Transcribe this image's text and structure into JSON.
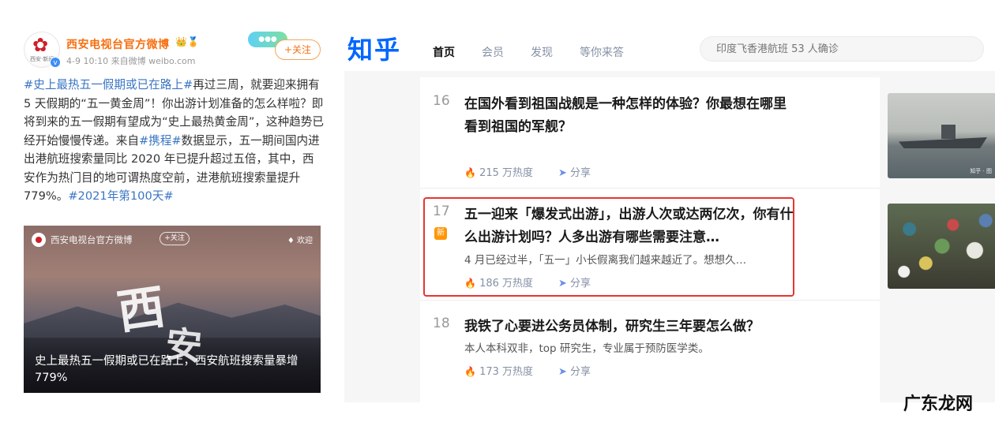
{
  "weibo": {
    "account_name": "西安电视台官方微博",
    "name_icons": "👑🏅",
    "meta": "4-9 10:10  来自微博 weibo.com",
    "tag_badge": "●●●",
    "follow_label": "+关注",
    "avatar_text": "西安·新闻",
    "avatar_badge": "v",
    "post_hashtag": "#史上最热五一假期或已在路上#",
    "post_body": "再过三周，就要迎来拥有 5 天假期的“五一黄金周”！你出游计划准备的怎么样啦？即将到来的五一假期有望成为“史上最热黄金周”，这种趋势已经开始慢慢传递。来自",
    "post_hashtag2": "#携程#",
    "post_body2": "数据显示，五一期间国内进出港航班搜索量同比 2020 年已提升超过五倍，其中，西安作为热门目的地可谓热度空前，进港航班搜索量提升 779%。",
    "post_hashtag3": "#2021年第100天#",
    "card": {
      "account": "西安电视台官方微博",
      "follow": "+关注",
      "like": "♦ 欢迎",
      "big_char_1": "西",
      "big_char_2": "安",
      "caption": "史上最热五一假期或已在路上，西安航班搜索量暴增 779%"
    }
  },
  "zhihu": {
    "logo": "知乎",
    "nav": [
      "首页",
      "会员",
      "发现",
      "等你来答"
    ],
    "search_placeholder": "印度飞香港航班 53 人确诊",
    "items": [
      {
        "rank": "16",
        "title": "在国外看到祖国战舰是一种怎样的体验？你最想在哪里看到祖国的军舰？",
        "excerpt": "",
        "heat": "215 万热度",
        "share": "分享",
        "thumb": "warship-photo",
        "thumb_watermark": "知乎 · 图"
      },
      {
        "rank": "17",
        "badge": "新",
        "title": "五一迎来「爆发式出游」，出游人次或达两亿次，你有什么出游计划吗？人多出游有哪些需要注意…",
        "excerpt": "4 月已经过半，「五一」小长假离我们越来越近了。想想久…",
        "heat": "186 万热度",
        "share": "分享",
        "thumb": "crowd-photo"
      },
      {
        "rank": "18",
        "title": "我铁了心要进公务员体制，研究生三年要怎么做？",
        "excerpt": "本人本科双非，top 研究生，专业属于预防医学类。",
        "heat": "173 万热度",
        "share": "分享"
      }
    ]
  },
  "watermark": "广东龙网",
  "colors": {
    "zhihu_blue": "#0066ff",
    "weibo_orange": "#f66f10",
    "weibo_tag_blue": "#3a75c4",
    "highlight_red": "#e8342f"
  }
}
